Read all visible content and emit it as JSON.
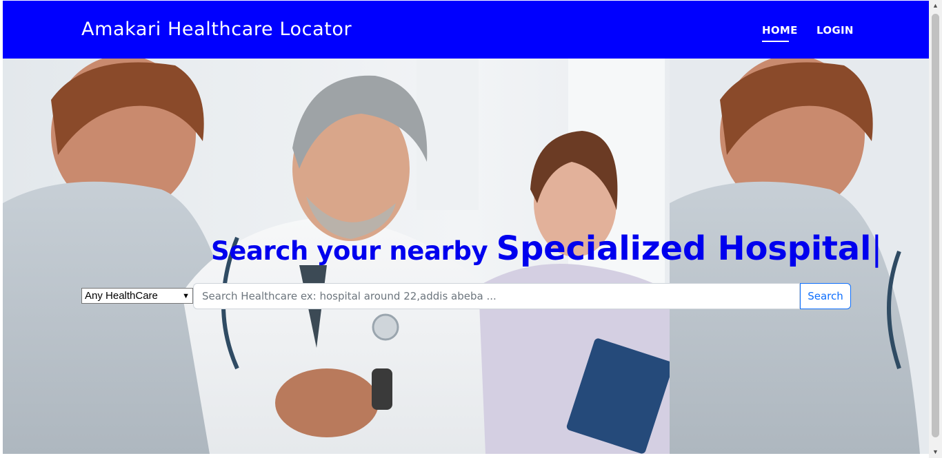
{
  "navbar": {
    "brand": "Amakari Healthcare Locator",
    "links": [
      {
        "label": "HOME",
        "active": true
      },
      {
        "label": "LOGIN",
        "active": false
      }
    ]
  },
  "hero": {
    "headline_lead": "Search your nearby ",
    "headline_typed": "Specialized Hospital",
    "cursor": "|"
  },
  "search": {
    "category_selected": "Any HealthCare",
    "placeholder": "Search Healthcare ex: hospital around 22,addis abeba ...",
    "value": "",
    "button_label": "Search"
  },
  "colors": {
    "navbar": "#0000ff",
    "headline": "#0000ee",
    "search_button": "#0d6efd"
  },
  "icons": {
    "select_arrow": "chevron-down-icon",
    "scroll_up": "triangle-up-icon",
    "scroll_down": "triangle-down-icon"
  }
}
